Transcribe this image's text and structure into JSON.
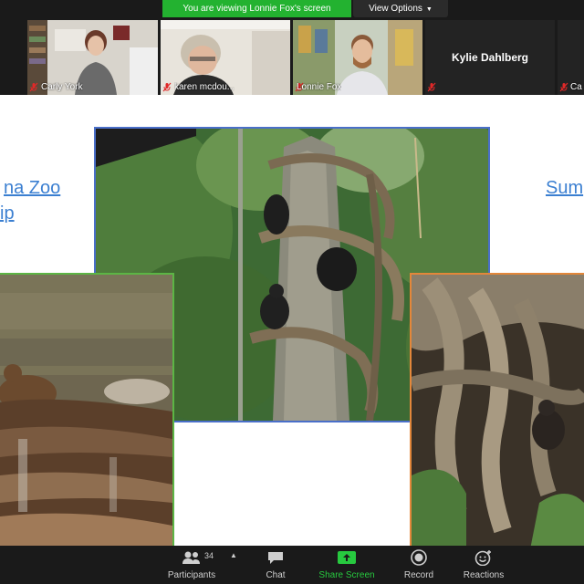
{
  "banner": {
    "share_text": "You are viewing Lonnie Fox's screen",
    "view_options": "View Options"
  },
  "participants": [
    {
      "name": "Carly York",
      "muted": true
    },
    {
      "name": "karen mcdou...",
      "muted": true
    },
    {
      "name": "Lonnie Fox",
      "muted": true
    },
    {
      "name": "Kylie Dahlberg",
      "muted": true
    },
    {
      "name": "Ca",
      "muted": true
    }
  ],
  "shared_page": {
    "left_link_line1": "na Zoo",
    "left_link_line2": "ip",
    "right_link": "Sum"
  },
  "toolbar": {
    "participants_label": "Participants",
    "participants_count": "34",
    "chat_label": "Chat",
    "share_label": "Share Screen",
    "record_label": "Record",
    "reactions_label": "Reactions"
  },
  "colors": {
    "share_green": "#23b230",
    "toolbar_bg": "#1a1a1a",
    "link_blue": "#3b7fd1",
    "frame_blue": "#4a6fc9",
    "frame_green": "#5cb545",
    "frame_orange": "#e3873a",
    "mic_red": "#e02828"
  }
}
